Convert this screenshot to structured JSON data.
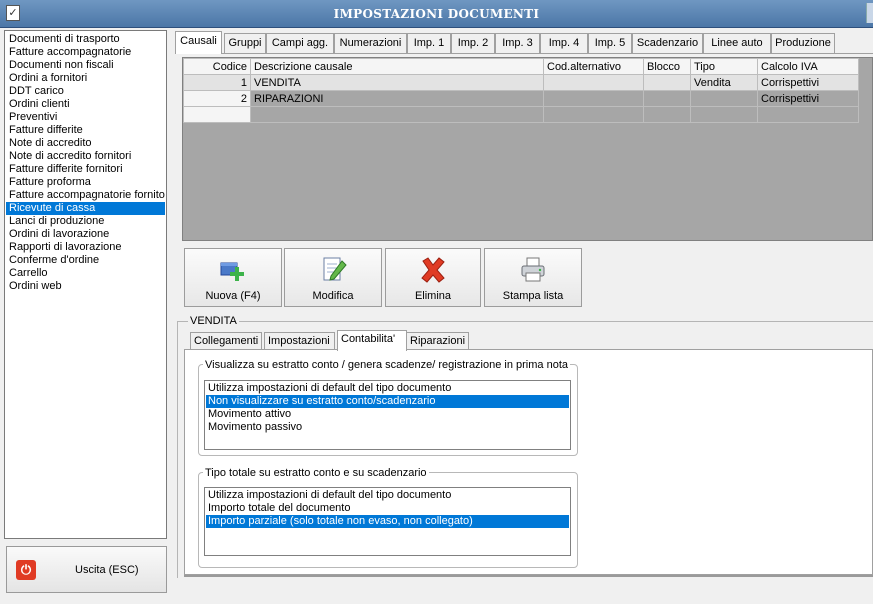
{
  "window": {
    "title": "IMPOSTAZIONI DOCUMENTI",
    "app_icon": "checkbox-icon"
  },
  "doc_types": [
    "Documenti di trasporto",
    "Fatture accompagnatorie",
    "Documenti non fiscali",
    "Ordini a fornitori",
    "DDT carico",
    "Ordini clienti",
    "Preventivi",
    "Fatture differite",
    "Note di accredito",
    "Note di accredito fornitori",
    "Fatture differite fornitori",
    "Fatture proforma",
    "Fatture accompagnatorie fornitori",
    "Ricevute di cassa",
    "Lanci di produzione",
    "Ordini di lavorazione",
    "Rapporti di lavorazione",
    "Conferme d'ordine",
    "Carrello",
    "Ordini web"
  ],
  "selected_doc_type": "Ricevute di cassa",
  "exit_button": {
    "label": "Uscita (ESC)",
    "icon": "power-icon"
  },
  "tabs": [
    "Causali",
    "Gruppi",
    "Campi agg.",
    "Numerazioni",
    "Imp. 1",
    "Imp. 2",
    "Imp. 3",
    "Imp. 4",
    "Imp. 5",
    "Scadenzario",
    "Linee auto",
    "Produzione"
  ],
  "active_tab": "Causali",
  "grid": {
    "columns": [
      "Codice",
      "Descrizione causale",
      "Cod.alternativo",
      "Blocco",
      "Tipo",
      "Calcolo IVA"
    ],
    "rows": [
      {
        "codice": "1",
        "descrizione": "VENDITA",
        "cod_alternativo": "",
        "blocco": "",
        "tipo": "Vendita",
        "calcolo_iva": "Corrispettivi"
      },
      {
        "codice": "2",
        "descrizione": "RIPARAZIONI",
        "cod_alternativo": "",
        "blocco": "",
        "tipo": "",
        "calcolo_iva": "Corrispettivi"
      }
    ]
  },
  "actions": {
    "new": {
      "label": "Nuova (F4)",
      "icon": "add-window-icon"
    },
    "edit": {
      "label": "Modifica",
      "icon": "edit-document-icon"
    },
    "delete": {
      "label": "Elimina",
      "icon": "delete-x-icon"
    },
    "print": {
      "label": "Stampa lista",
      "icon": "printer-icon"
    }
  },
  "detail": {
    "title": "VENDITA",
    "subtabs": [
      "Collegamenti",
      "Impostazioni",
      "Contabilita'",
      "Riparazioni"
    ],
    "active_subtab": "Contabilita'",
    "group1": {
      "label": "Visualizza su estratto conto / genera scadenze/ registrazione  in prima nota",
      "options": [
        "Utilizza impostazioni di default del tipo documento",
        "Non visualizzare su estratto conto/scadenzario",
        "Movimento attivo",
        "Movimento passivo"
      ],
      "selected": "Non visualizzare su estratto conto/scadenzario"
    },
    "group2": {
      "label": "Tipo totale su estratto conto e su scadenzario",
      "options": [
        "Utilizza impostazioni di default del tipo documento",
        "Importo totale del documento",
        "Importo parziale (solo totale non evaso, non collegato)"
      ],
      "selected": "Importo parziale (solo totale non evaso, non collegato)"
    }
  },
  "colors": {
    "selection": "#0078d7",
    "titlebar": "#5a85b5",
    "delete_red": "#e03b24",
    "add_green": "#3cb34a"
  }
}
